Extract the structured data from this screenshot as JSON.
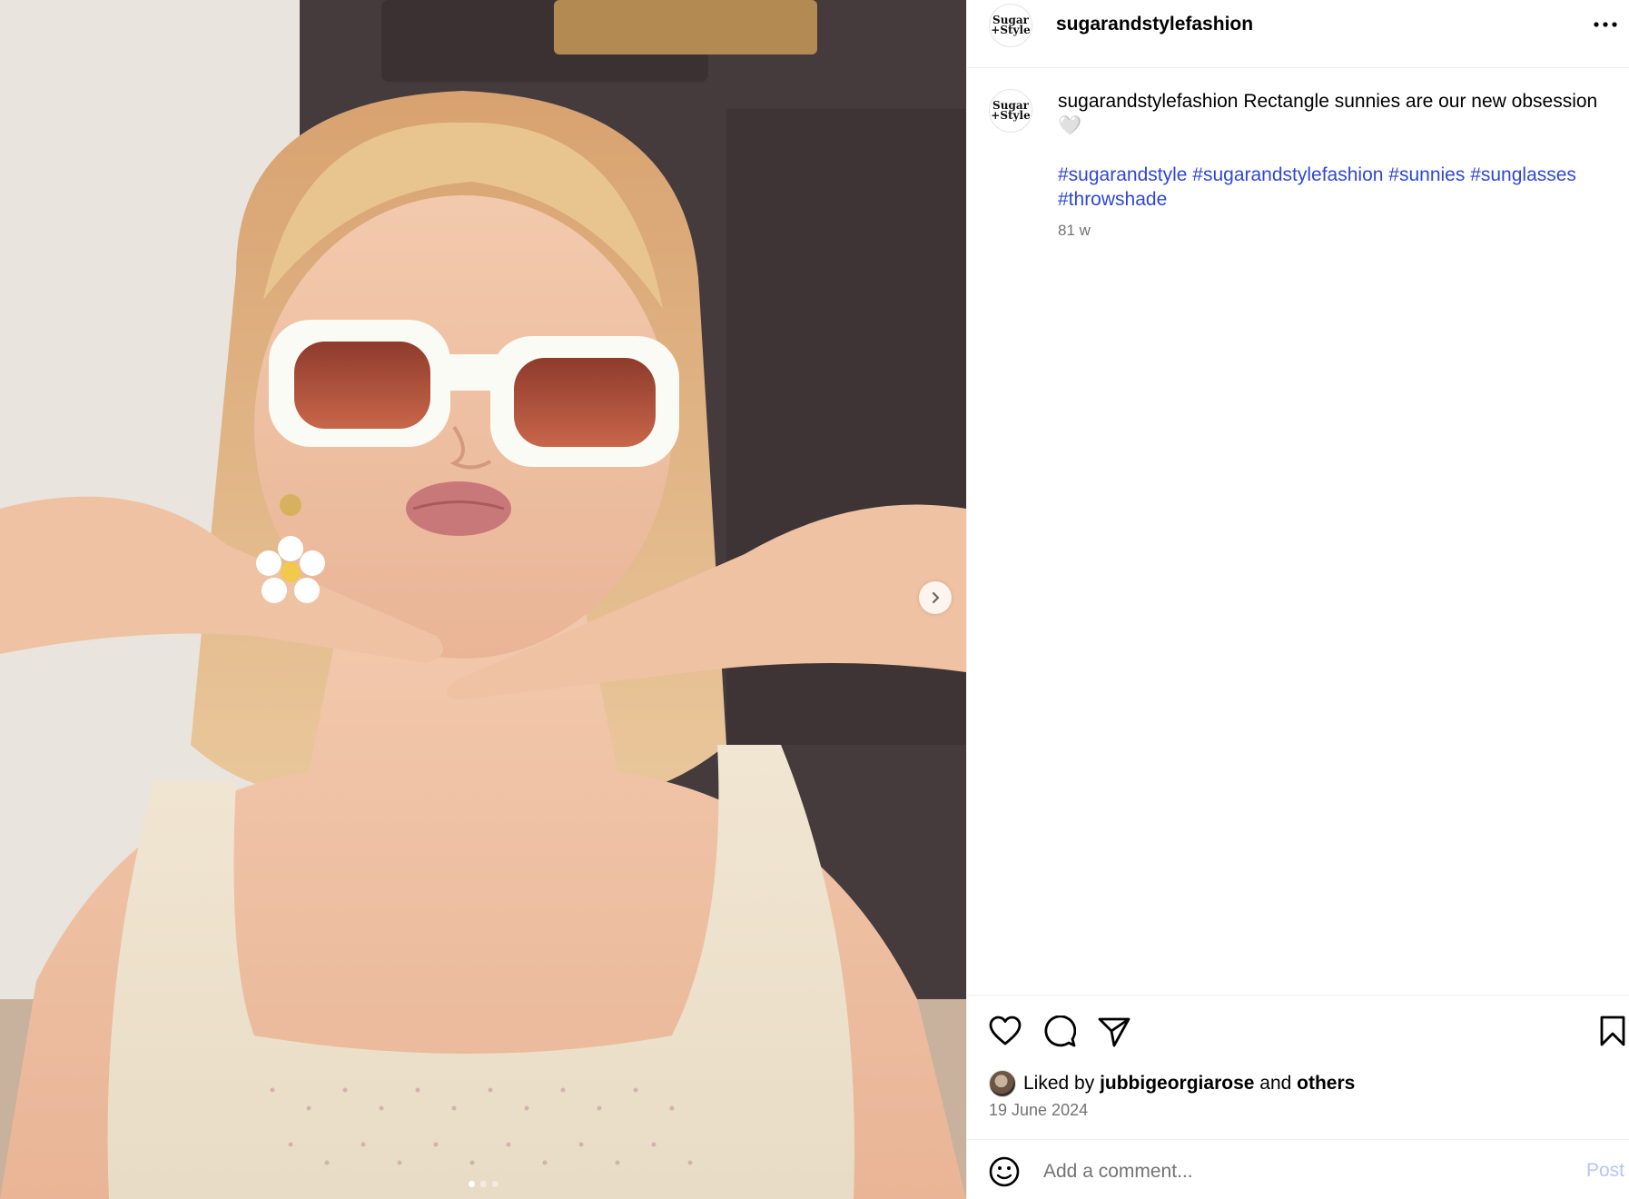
{
  "post": {
    "username": "sugarandstylefashion",
    "avatar_text_line1": "Sugar",
    "avatar_text_line2": "+Style",
    "more_icon": "more-horizontal-icon"
  },
  "media": {
    "alt": "Woman wearing white rectangle sunglasses with daisy earrings",
    "carousel_count": 3,
    "carousel_active": 1,
    "next_icon": "chevron-right-icon"
  },
  "caption": {
    "username": "sugarandstylefashion",
    "text": "Rectangle sunnies are our new obsession 🤍",
    "hashtags": [
      "#sugarandstyle",
      "#sugarandstylefashion",
      "#sunnies",
      "#sunglasses",
      "#throwshade"
    ],
    "time": "81 w"
  },
  "actions": {
    "like_icon": "heart-icon",
    "comment_icon": "comment-icon",
    "share_icon": "send-icon",
    "save_icon": "bookmark-icon"
  },
  "likes": {
    "prefix": "Liked by",
    "user": "jubbigeorgiarose",
    "connector": "and",
    "others": "others"
  },
  "date": "19 June 2024",
  "comment": {
    "emoji_icon": "emoji-icon",
    "placeholder": "Add a comment...",
    "post_label": "Post"
  },
  "colors": {
    "link": "#2f47d6",
    "muted": "#737373",
    "post_disabled": "#b6c6f5"
  }
}
